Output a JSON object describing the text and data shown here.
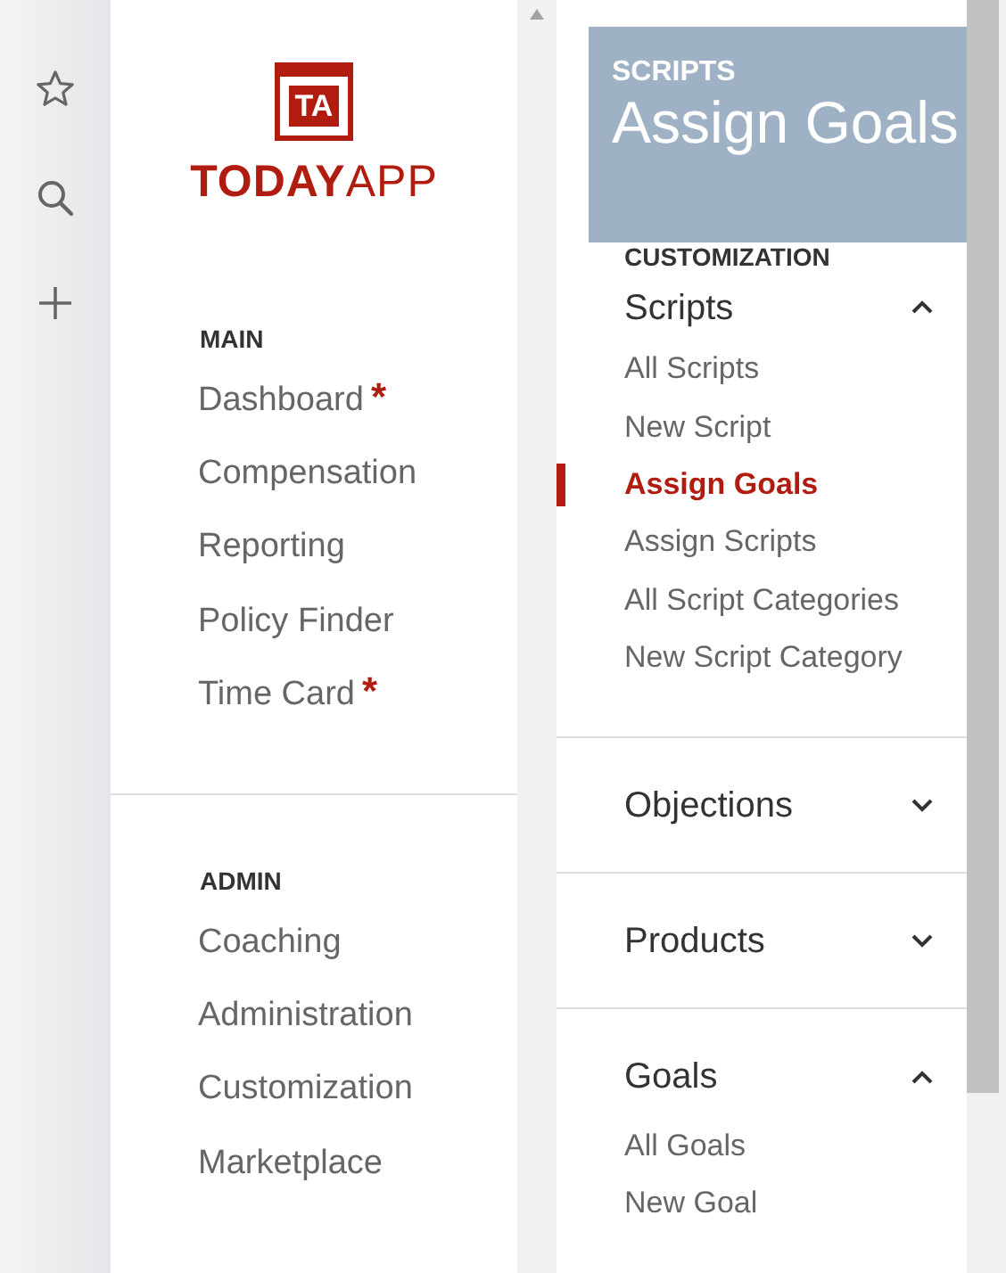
{
  "rail": {
    "icons": [
      {
        "kind": "star"
      },
      {
        "kind": "search"
      },
      {
        "kind": "plus"
      }
    ]
  },
  "logo": {
    "mark": "TA",
    "brand_bold": "TODAY",
    "brand_light": "APP"
  },
  "nav_sections": [
    {
      "title": "MAIN",
      "items": [
        {
          "label": "Dashboard",
          "marker": "*"
        },
        {
          "label": "Compensation"
        },
        {
          "label": "Reporting"
        },
        {
          "label": "Policy Finder"
        },
        {
          "label": "Time Card",
          "marker": "*"
        }
      ]
    },
    {
      "title": "ADMIN",
      "items": [
        {
          "label": "Coaching"
        },
        {
          "label": "Administration"
        },
        {
          "label": "Customization"
        },
        {
          "label": "Marketplace"
        }
      ]
    }
  ],
  "background_header": {
    "eyebrow": "SCRIPTS",
    "title": "Assign Goals"
  },
  "submenu": {
    "title": "CUSTOMIZATION",
    "groups": [
      {
        "label": "Scripts",
        "expanded": true,
        "items": [
          {
            "label": "All Scripts",
            "selected": false
          },
          {
            "label": "New Script",
            "selected": false
          },
          {
            "label": "Assign Goals",
            "selected": true
          },
          {
            "label": "Assign Scripts",
            "selected": false
          },
          {
            "label": "All Script Categories",
            "selected": false
          },
          {
            "label": "New Script Category",
            "selected": false
          }
        ]
      },
      {
        "label": "Objections",
        "expanded": false
      },
      {
        "label": "Products",
        "expanded": false
      },
      {
        "label": "Goals",
        "expanded": true,
        "items": [
          {
            "label": "All Goals",
            "selected": false
          },
          {
            "label": "New Goal",
            "selected": false
          }
        ]
      }
    ]
  }
}
